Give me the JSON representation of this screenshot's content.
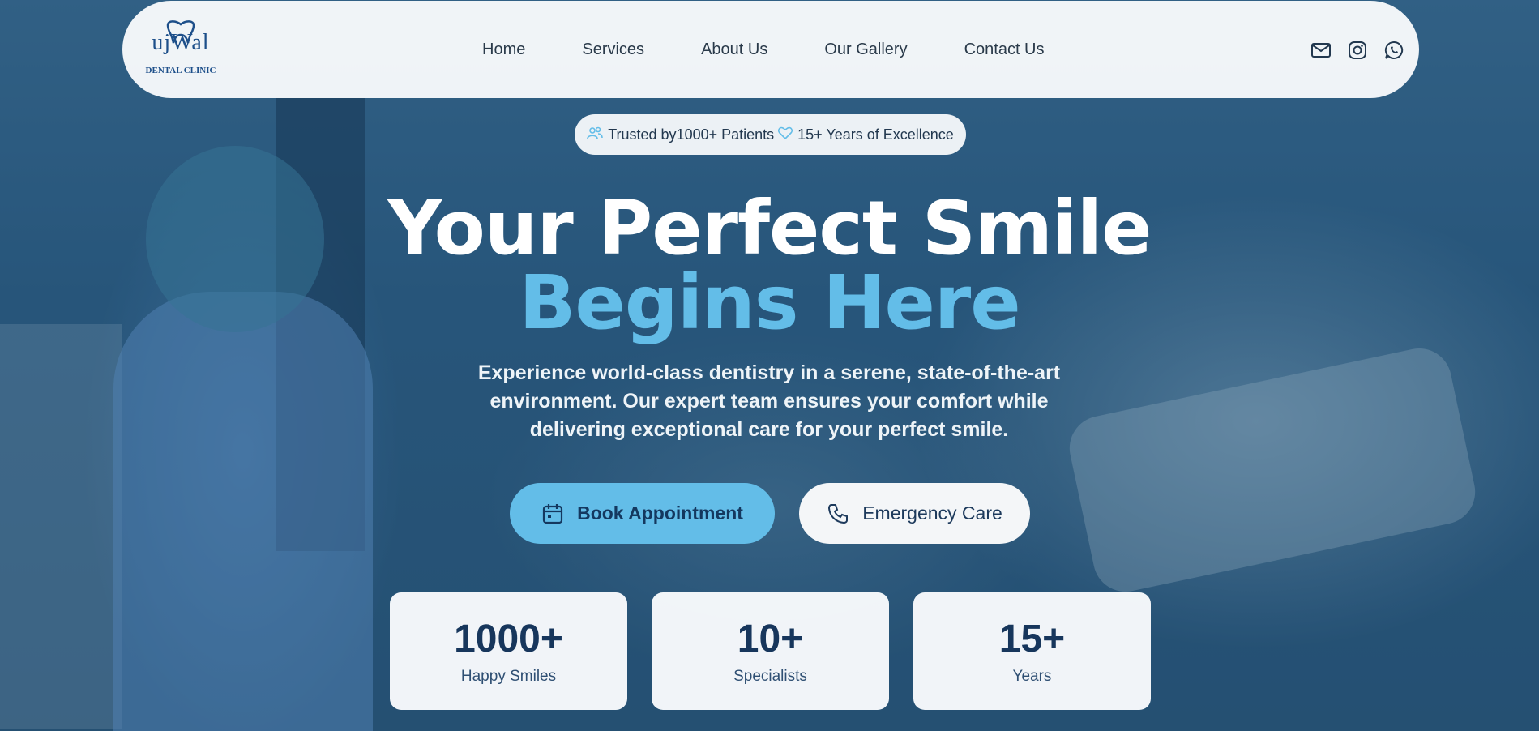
{
  "brand": {
    "logo_text": "ujWal",
    "logo_subtitle": "DENTAL CLINIC",
    "logo_color": "#1d4f8a"
  },
  "nav": {
    "items": [
      {
        "label": "Home"
      },
      {
        "label": "Services"
      },
      {
        "label": "About Us"
      },
      {
        "label": "Our Gallery"
      },
      {
        "label": "Contact Us"
      }
    ]
  },
  "social": [
    {
      "icon": "mail-icon"
    },
    {
      "icon": "instagram-icon"
    },
    {
      "icon": "whatsapp-icon"
    }
  ],
  "trust_badge": {
    "patients_text": "Trusted by1000+ Patients",
    "years_text": "15+ Years of Excellence",
    "patients_icon": "users-icon",
    "years_icon": "heart-icon"
  },
  "hero": {
    "title_line1": "Your Perfect Smile",
    "title_line2": "Begins Here",
    "description": "Experience world-class dentistry in a serene, state-of-the-art environment. Our expert team ensures your comfort while delivering exceptional care for your perfect smile.",
    "accent_color": "#63bde8"
  },
  "actions": {
    "book_label": "Book Appointment",
    "book_icon": "calendar-icon",
    "emergency_label": "Emergency Care",
    "emergency_icon": "phone-icon"
  },
  "stats": [
    {
      "value": "1000+",
      "label": "Happy Smiles"
    },
    {
      "value": "10+",
      "label": "Specialists"
    },
    {
      "value": "15+",
      "label": "Years"
    }
  ]
}
